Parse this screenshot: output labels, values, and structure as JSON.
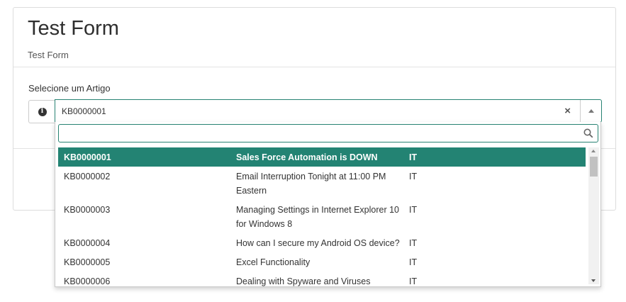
{
  "header": {
    "title": "Test Form",
    "subtitle": "Test Form"
  },
  "field": {
    "label": "Selecione um Artigo",
    "info_icon": "info-circle-icon",
    "selected_value": "KB0000001",
    "clear_glyph": "×"
  },
  "dropdown": {
    "search_placeholder": "",
    "accent_color": "#238373",
    "options": [
      {
        "number": "KB0000001",
        "title": "Sales Force Automation is DOWN",
        "category": "IT",
        "selected": true
      },
      {
        "number": "KB0000002",
        "title": "Email Interruption Tonight at 11:00 PM Eastern",
        "category": "IT",
        "selected": false
      },
      {
        "number": "KB0000003",
        "title": "Managing Settings in Internet Explorer 10 for Windows 8",
        "category": "IT",
        "selected": false
      },
      {
        "number": "KB0000004",
        "title": "How can I secure my Android OS device?",
        "category": "IT",
        "selected": false
      },
      {
        "number": "KB0000005",
        "title": "Excel Functionality",
        "category": "IT",
        "selected": false
      },
      {
        "number": "KB0000006",
        "title": "Dealing with Spyware and Viruses",
        "category": "IT",
        "selected": false
      }
    ]
  }
}
